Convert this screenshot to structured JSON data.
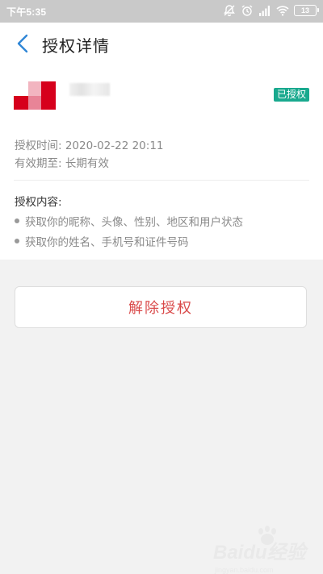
{
  "status_bar": {
    "time": "下午5:35",
    "battery": "13"
  },
  "header": {
    "title": "授权详情"
  },
  "app": {
    "badge": "已授权"
  },
  "auth_info": {
    "auth_time": "授权时间: 2020-02-22 20:11",
    "valid_until": "有效期至: 长期有效"
  },
  "permissions": {
    "heading": "授权内容:",
    "items": [
      "获取你的昵称、头像、性别、地区和用户状态",
      "获取你的姓名、手机号和证件号码"
    ]
  },
  "actions": {
    "revoke_label": "解除授权"
  },
  "watermark": {
    "brand": "Baidu经验",
    "sub": "jingyan.baidu.com"
  },
  "colors": {
    "badge": "#19a98e",
    "revoke_text": "#d94a4a",
    "back_arrow": "#2f86d6",
    "logo_red": "#d6001c"
  }
}
